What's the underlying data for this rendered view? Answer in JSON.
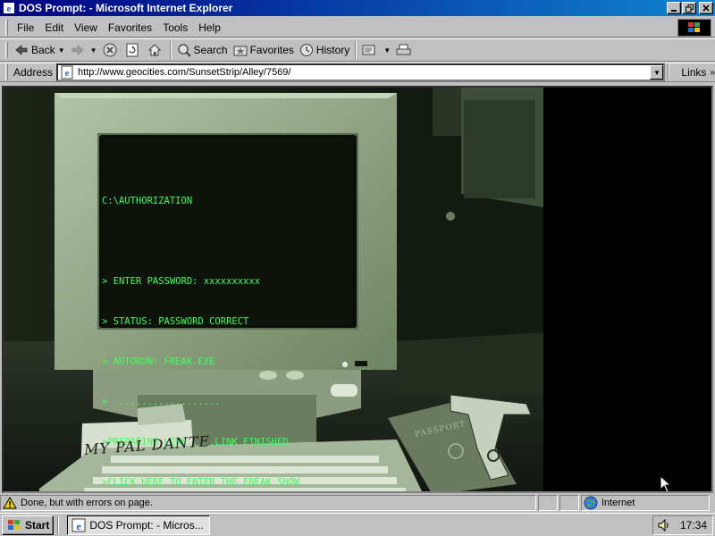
{
  "window": {
    "title": "DOS Prompt: - Microsoft Internet Explorer",
    "icon": "ie-icon",
    "controls": [
      "minimize",
      "maximize",
      "close"
    ]
  },
  "menu": {
    "items": [
      "File",
      "Edit",
      "View",
      "Favorites",
      "Tools",
      "Help"
    ]
  },
  "toolbar": {
    "back_label": "Back",
    "search_label": "Search",
    "favorites_label": "Favorites",
    "history_label": "History"
  },
  "address": {
    "label": "Address",
    "url": "http://www.geocities.com/SunsetStrip/Alley/7569/",
    "links_label": "Links"
  },
  "page": {
    "dos_lines": [
      "C:\\AUTHORIZATION",
      "",
      "> ENTER PASSWORD: xxxxxxxxxx",
      "> STATUS: PASSWORD CORRECT",
      "> AUTORUN: FREAK.EXE",
      ">  ..................",
      ">PREPARING LINK.....LINK FINISHED",
      ">CLICK HERE TO ENTER THE FREAK SHOW"
    ],
    "note_signature": "MY PAL DANTE",
    "passport_label": "PASSPORT",
    "text_color": "#3cff5a"
  },
  "status": {
    "message": "Done, but with errors on page.",
    "zone": "Internet"
  },
  "taskbar": {
    "start_label": "Start",
    "task_label": "DOS Prompt: - Micros...",
    "clock": "17:34"
  }
}
